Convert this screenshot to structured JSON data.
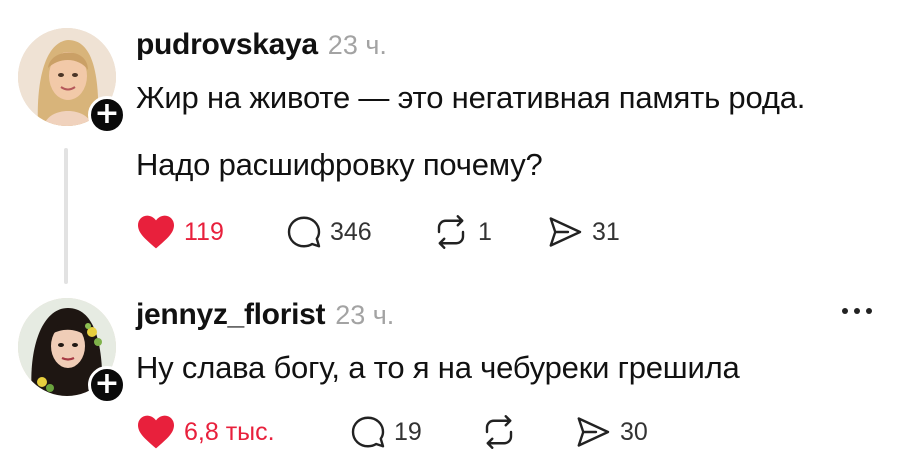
{
  "posts": [
    {
      "username": "pudrovskaya",
      "time": "23 ч.",
      "lines": [
        "Жир на животе — это негативная память рода.",
        "Надо расшифровку почему?"
      ],
      "likes": "119",
      "comments": "346",
      "reposts": "1",
      "shares": "31",
      "liked": true,
      "avatar_icon": "woman-blonde-avatar"
    },
    {
      "username": "jennyz_florist",
      "time": "23 ч.",
      "lines": [
        "Ну слава богу, а то я на чебуреки грешила"
      ],
      "likes": "6,8 тыс.",
      "comments": "19",
      "reposts": "",
      "shares": "30",
      "liked": true,
      "avatar_icon": "woman-dark-hair-flowers-avatar"
    }
  ],
  "colors": {
    "like": "#e8203c",
    "text": "#111111",
    "muted": "#a3a3a3",
    "thread_line": "#e2e2e2"
  },
  "icons": {
    "follow": "plus-icon",
    "like": "heart-icon",
    "comment": "speech-bubble-icon",
    "repost": "repost-arrows-icon",
    "share": "paper-plane-icon",
    "more": "ellipsis-icon"
  }
}
